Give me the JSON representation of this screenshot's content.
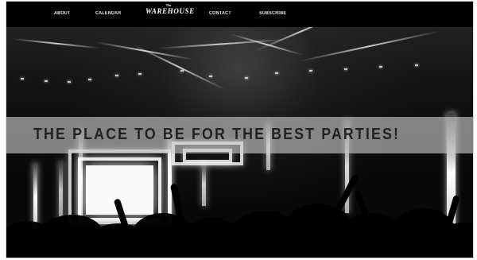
{
  "header": {
    "nav": {
      "about": "ABOUT",
      "calendar": "CALENDAR",
      "contact": "CONTACT",
      "subscribe": "SUBSCRIBE"
    },
    "logo": {
      "small": "The",
      "main": "Warehouse"
    }
  },
  "hero": {
    "headline": "THE PLACE TO BE FOR THE BEST PARTIES!"
  },
  "colors": {
    "page_background": "#ffffff",
    "site_background": "#050505",
    "nav_text": "#f2f2f2",
    "banner_background": "#cdcdcd",
    "banner_text": "#222222"
  }
}
